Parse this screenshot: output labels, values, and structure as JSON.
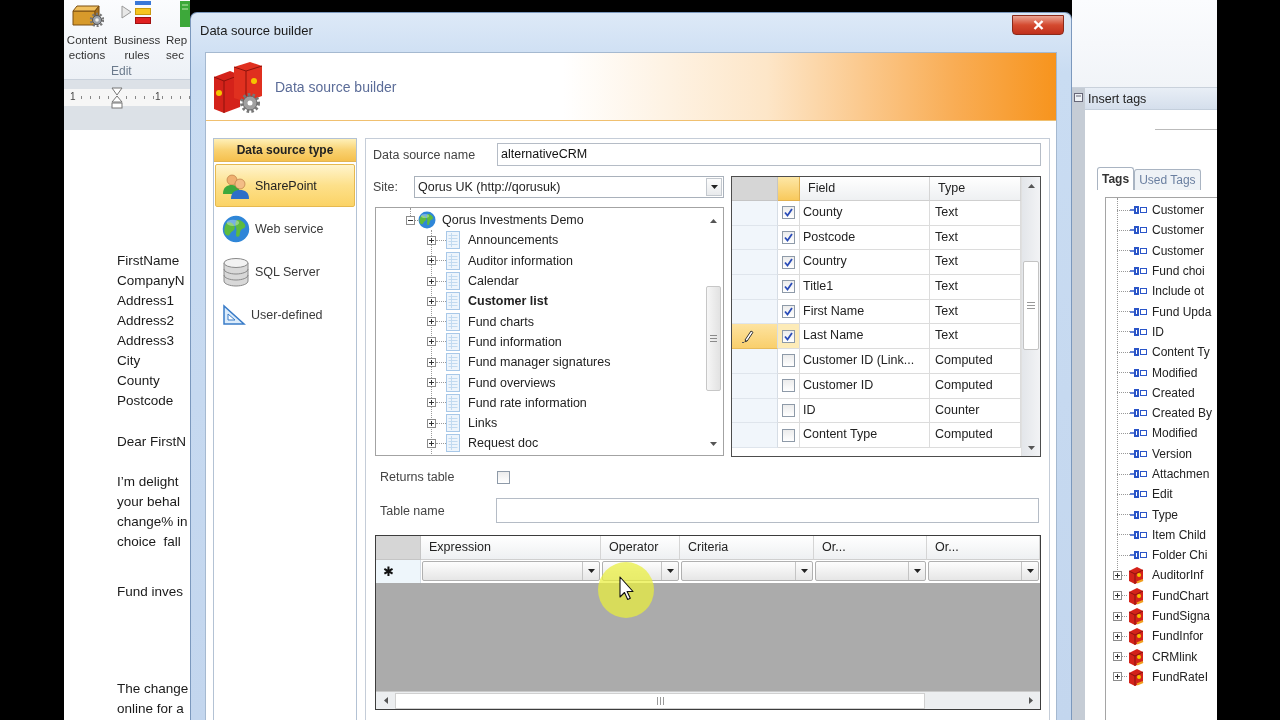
{
  "word": {
    "ribbon_buttons": [
      {
        "kind": "toolbox",
        "lines": [
          "Content",
          "ections"
        ]
      },
      {
        "kind": "rules",
        "lines": [
          "Business",
          "rules"
        ]
      },
      {
        "kind": "sheet",
        "lines": [
          "Rep",
          "sec"
        ]
      }
    ],
    "ribbon_group": "Edit",
    "ruler_numbers": [
      "1",
      "1"
    ],
    "document": [
      {
        "lines": [
          "FirstName",
          "CompanyN",
          "Address1",
          "Address2",
          "Address3",
          "City",
          "County",
          "Postcode"
        ]
      },
      {
        "lines": [
          "Dear FirstN"
        ]
      },
      {
        "lines": [
          "I’m delight",
          "your behal",
          "change% in",
          "choice  fall"
        ]
      },
      {
        "lines": [
          "Fund inves"
        ]
      },
      {
        "lines": [
          "The change",
          "online for a"
        ]
      }
    ]
  },
  "dialog": {
    "title": "Data source builder",
    "header": "Data source builder",
    "source_types": {
      "title": "Data source type",
      "items": [
        {
          "kind": "sharepoint",
          "label": "SharePoint",
          "selected": true
        },
        {
          "kind": "web",
          "label": "Web service",
          "selected": false
        },
        {
          "kind": "sql",
          "label": "SQL Server",
          "selected": false
        },
        {
          "kind": "custom",
          "label": "User-defined",
          "selected": false
        }
      ]
    },
    "name_field": {
      "label": "Data source name",
      "value": "alternativeCRM"
    },
    "site": {
      "label": "Site:",
      "value": "Qorus UK (http://qorusuk)"
    },
    "tree": {
      "label": "Qorus Investments Demo",
      "expanded": true,
      "selected": false,
      "children": [
        {
          "label": "Announcements",
          "expanded": false,
          "selected": false
        },
        {
          "label": "Auditor information",
          "expanded": false,
          "selected": false
        },
        {
          "label": "Calendar",
          "expanded": false,
          "selected": false
        },
        {
          "label": "Customer list",
          "expanded": false,
          "selected": true
        },
        {
          "label": "Fund charts",
          "expanded": false,
          "selected": false
        },
        {
          "label": "Fund information",
          "expanded": false,
          "selected": false
        },
        {
          "label": "Fund manager signatures",
          "expanded": false,
          "selected": false
        },
        {
          "label": "Fund overviews",
          "expanded": false,
          "selected": false
        },
        {
          "label": "Fund rate information",
          "expanded": false,
          "selected": false
        },
        {
          "label": "Links",
          "expanded": false,
          "selected": false
        },
        {
          "label": "Request doc",
          "expanded": false,
          "selected": false
        }
      ]
    },
    "fields": {
      "columns": [
        "Field",
        "Type"
      ],
      "rows": [
        {
          "field": "County",
          "type": "Text",
          "checked": true,
          "current": false
        },
        {
          "field": "Postcode",
          "type": "Text",
          "checked": true,
          "current": false
        },
        {
          "field": "Country",
          "type": "Text",
          "checked": true,
          "current": false
        },
        {
          "field": "Title1",
          "type": "Text",
          "checked": true,
          "current": false
        },
        {
          "field": "First Name",
          "type": "Text",
          "checked": true,
          "current": false
        },
        {
          "field": "Last Name",
          "type": "Text",
          "checked": true,
          "current": true
        },
        {
          "field": "Customer ID (Link...",
          "type": "Computed",
          "checked": false,
          "current": false
        },
        {
          "field": "Customer ID",
          "type": "Computed",
          "checked": false,
          "current": false
        },
        {
          "field": "ID",
          "type": "Counter",
          "checked": false,
          "current": false
        },
        {
          "field": "Content Type",
          "type": "Computed",
          "checked": false,
          "current": false
        }
      ]
    },
    "returns_table": {
      "label": "Returns table",
      "checked": false
    },
    "table_name": {
      "label": "Table name"
    },
    "criteria": {
      "columns": [
        "Expression",
        "Operator",
        "Criteria",
        "Or...",
        "Or..."
      ],
      "new_row_marker": "✱"
    }
  },
  "insert_tags": {
    "title": "Insert tags",
    "tabs": [
      {
        "label": "Tags",
        "selected": true
      },
      {
        "label": "Used Tags",
        "selected": false
      }
    ],
    "items": [
      {
        "kind": "field",
        "label": "Customer"
      },
      {
        "kind": "field",
        "label": "Customer"
      },
      {
        "kind": "field",
        "label": "Customer"
      },
      {
        "kind": "field",
        "label": "Fund choi"
      },
      {
        "kind": "field",
        "label": "Include ot"
      },
      {
        "kind": "field",
        "label": "Fund Upda"
      },
      {
        "kind": "field",
        "label": "ID"
      },
      {
        "kind": "field",
        "label": "Content Ty"
      },
      {
        "kind": "field",
        "label": "Modified"
      },
      {
        "kind": "field",
        "label": "Created"
      },
      {
        "kind": "field",
        "label": "Created By"
      },
      {
        "kind": "field",
        "label": "Modified"
      },
      {
        "kind": "field",
        "label": "Version"
      },
      {
        "kind": "field",
        "label": "Attachmen"
      },
      {
        "kind": "field",
        "label": "Edit"
      },
      {
        "kind": "field",
        "label": "Type"
      },
      {
        "kind": "field",
        "label": "Item Child"
      },
      {
        "kind": "field",
        "label": "Folder Chi"
      },
      {
        "kind": "group",
        "label": "AuditorInf",
        "expanded": false
      },
      {
        "kind": "group",
        "label": "FundChart",
        "expanded": false
      },
      {
        "kind": "group",
        "label": "FundSigna",
        "expanded": false
      },
      {
        "kind": "group",
        "label": "FundInfor",
        "expanded": false
      },
      {
        "kind": "group",
        "label": "CRMlink",
        "expanded": false
      },
      {
        "kind": "group",
        "label": "FundRateI",
        "expanded": false
      }
    ]
  }
}
